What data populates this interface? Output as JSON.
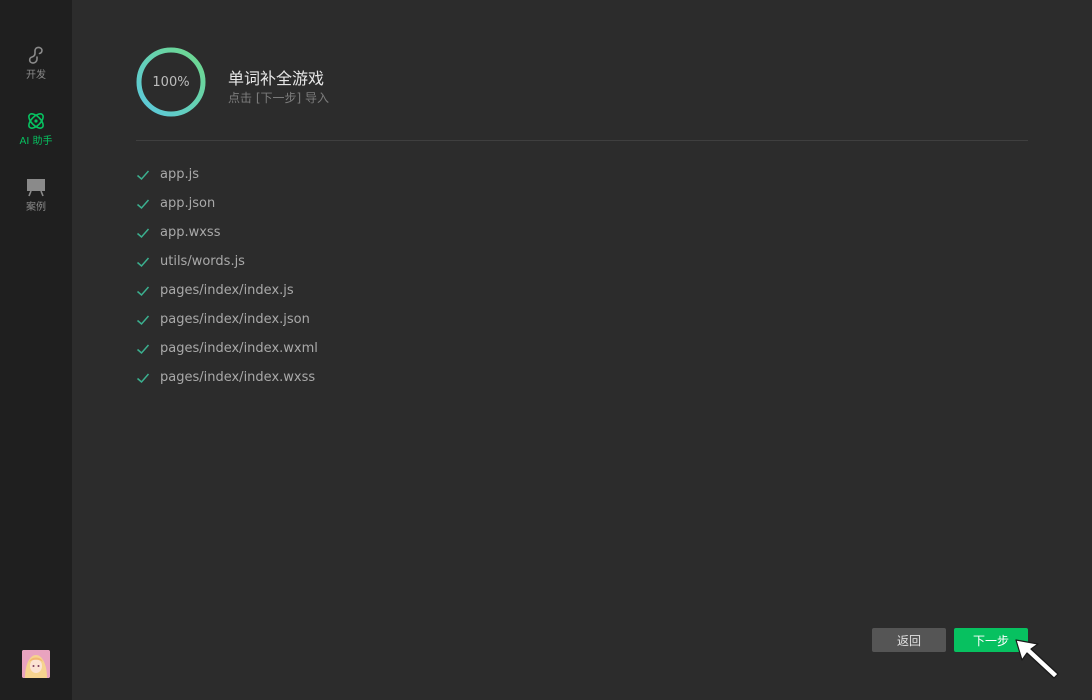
{
  "sidebar": {
    "items": [
      {
        "label": "开发",
        "icon": "mini-program-icon",
        "active": false
      },
      {
        "label": "AI 助手",
        "icon": "ai-assistant-icon",
        "active": true
      },
      {
        "label": "案例",
        "icon": "showcase-icon",
        "active": false
      }
    ],
    "avatar": "user-avatar"
  },
  "header": {
    "progress": "100%",
    "progress_value": 1.0,
    "title": "单词补全游戏",
    "subtitle": "点击 [下一步] 导入"
  },
  "files": [
    "app.js",
    "app.json",
    "app.wxss",
    "utils/words.js",
    "pages/index/index.js",
    "pages/index/index.json",
    "pages/index/index.wxml",
    "pages/index/index.wxss"
  ],
  "buttons": {
    "back_label": "返回",
    "next_label": "下一步"
  },
  "colors": {
    "accent": "#07c160",
    "check": "#3bb08f",
    "ring_start": "#5bc8e0",
    "ring_end": "#6fd98a"
  }
}
